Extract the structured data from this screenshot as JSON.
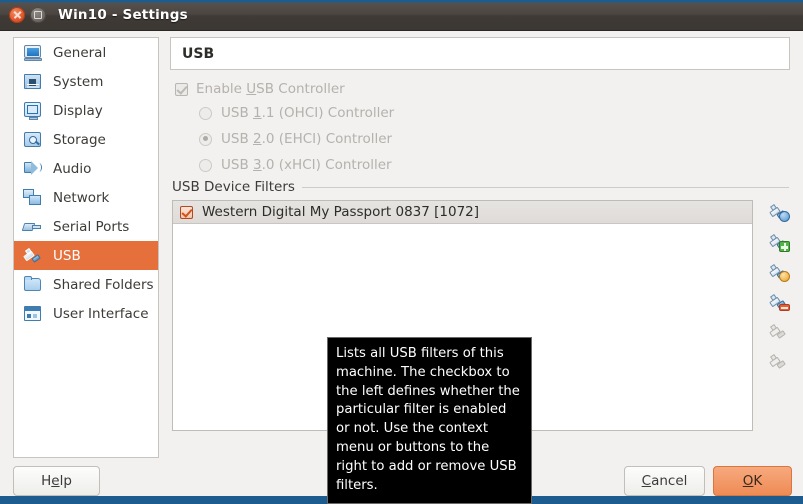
{
  "window": {
    "title": "Win10 - Settings",
    "close_label": "close-button",
    "maximize_label": "maximize-button"
  },
  "sidebar": {
    "items": [
      {
        "label": "General",
        "icon": "monitor-icon",
        "selected": false
      },
      {
        "label": "System",
        "icon": "chip-icon",
        "selected": false
      },
      {
        "label": "Display",
        "icon": "display-icon",
        "selected": false
      },
      {
        "label": "Storage",
        "icon": "hard-disk-icon",
        "selected": false
      },
      {
        "label": "Audio",
        "icon": "speaker-icon",
        "selected": false
      },
      {
        "label": "Network",
        "icon": "network-icon",
        "selected": false
      },
      {
        "label": "Serial Ports",
        "icon": "serial-port-icon",
        "selected": false
      },
      {
        "label": "USB",
        "icon": "usb-plug-icon",
        "selected": true
      },
      {
        "label": "Shared Folders",
        "icon": "folder-icon",
        "selected": false
      },
      {
        "label": "User Interface",
        "icon": "window-icon",
        "selected": false
      }
    ]
  },
  "pane": {
    "title": "USB",
    "enable_controller": {
      "label_before": "Enable ",
      "accelerator": "U",
      "label_after": "SB Controller",
      "checked": true,
      "enabled": false
    },
    "controllers": [
      {
        "label_before": "USB ",
        "accelerator": "1",
        "label_after": ".1 (OHCI) Controller",
        "selected": false,
        "enabled": false
      },
      {
        "label_before": "USB ",
        "accelerator": "2",
        "label_after": ".0 (EHCI) Controller",
        "selected": true,
        "enabled": false
      },
      {
        "label_before": "USB ",
        "accelerator": "3",
        "label_after": ".0 (xHCI) Controller",
        "selected": false,
        "enabled": false
      }
    ],
    "filters_group_label": "USB Device Filters",
    "filters": [
      {
        "name": "Western Digital My Passport 0837 [1072]",
        "checked": true,
        "selected": true
      }
    ],
    "filter_buttons": [
      {
        "icon": "add-filter-from-device-icon",
        "badge": "blue",
        "enabled": true
      },
      {
        "icon": "add-empty-filter-icon",
        "badge": "green",
        "enabled": true
      },
      {
        "icon": "edit-filter-icon",
        "badge": "orange",
        "enabled": true
      },
      {
        "icon": "remove-filter-icon",
        "badge": "red",
        "enabled": true
      },
      {
        "icon": "move-filter-up-icon",
        "badge": "none",
        "enabled": false
      },
      {
        "icon": "move-filter-down-icon",
        "badge": "none",
        "enabled": false
      }
    ]
  },
  "tooltip": {
    "text": "Lists all USB filters of this machine. The checkbox to the left defines whether the particular filter is enabled or not. Use the context menu or buttons to the right to add or remove USB filters."
  },
  "buttons": {
    "help": {
      "before": "H",
      "accelerator": "e",
      "after": "lp"
    },
    "cancel": {
      "before": "",
      "accelerator": "C",
      "after": "ancel"
    },
    "ok": {
      "before": "",
      "accelerator": "O",
      "after": "K"
    }
  },
  "colors": {
    "accent_orange": "#e6703c",
    "ok_button": "#ef8b55",
    "titlebar": "#3b3733",
    "window_bg": "#f2f1f0"
  }
}
